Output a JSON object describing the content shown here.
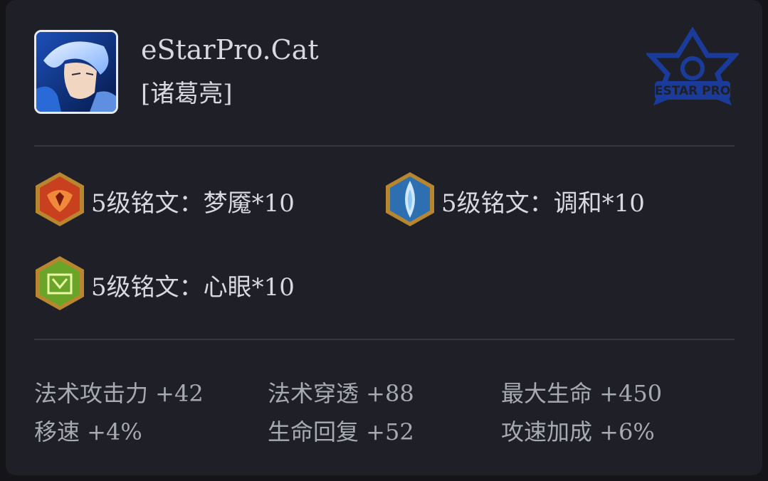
{
  "player": {
    "name": "eStarPro.Cat",
    "hero": "[诸葛亮]",
    "team_logo_text": "ESTAR PRO"
  },
  "runes": [
    {
      "label": "5级铭文：梦魇*10",
      "icon": "red-rune-icon",
      "color": "#c8401e"
    },
    {
      "label": "5级铭文：调和*10",
      "icon": "blue-rune-icon",
      "color": "#2d6fb0"
    },
    {
      "label": "5级铭文：心眼*10",
      "icon": "green-rune-icon",
      "color": "#6aa52a"
    }
  ],
  "stats": [
    {
      "label": "法术攻击力 +42"
    },
    {
      "label": "法术穿透 +88"
    },
    {
      "label": "最大生命 +450"
    },
    {
      "label": "移速 +4%"
    },
    {
      "label": "生命回复 +52"
    },
    {
      "label": "攻速加成 +6%"
    }
  ],
  "colors": {
    "card_bg": "#1f2027",
    "text_primary": "#d7d9df",
    "text_secondary": "#a8aab2",
    "logo_blue": "#1b3b9a"
  }
}
